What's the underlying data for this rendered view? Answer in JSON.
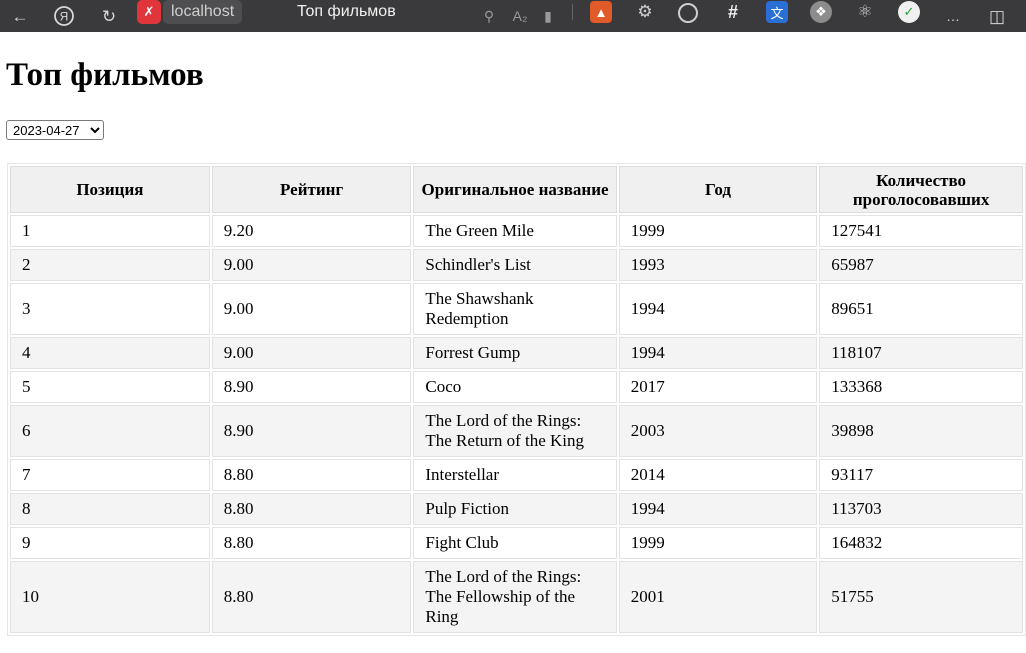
{
  "browser": {
    "url_host": "localhost",
    "tab_title": "Топ фильмов",
    "icons": [
      "back-arrow-icon",
      "yandex-icon",
      "reload-icon",
      "site-blocked-icon",
      "zoom-icon",
      "translate-icon",
      "bookmark-icon",
      "extension-icons",
      "more-icon",
      "sidebar-icon"
    ],
    "more_label": "…"
  },
  "page": {
    "title": "Топ фильмов",
    "date_select": {
      "selected": "2023-04-27",
      "options": [
        "2023-04-27"
      ]
    }
  },
  "table": {
    "headers": [
      "Позиция",
      "Рейтинг",
      "Оригинальное название",
      "Год",
      "Количество проголосовавших"
    ],
    "rows": [
      {
        "position": "1",
        "rating": "9.20",
        "title": "The Green Mile",
        "year": "1999",
        "votes": "127541"
      },
      {
        "position": "2",
        "rating": "9.00",
        "title": "Schindler's List",
        "year": "1993",
        "votes": "65987"
      },
      {
        "position": "3",
        "rating": "9.00",
        "title": "The Shawshank Redemption",
        "year": "1994",
        "votes": "89651"
      },
      {
        "position": "4",
        "rating": "9.00",
        "title": "Forrest Gump",
        "year": "1994",
        "votes": "118107"
      },
      {
        "position": "5",
        "rating": "8.90",
        "title": "Coco",
        "year": "2017",
        "votes": "133368"
      },
      {
        "position": "6",
        "rating": "8.90",
        "title": "The Lord of the Rings: The Return of the King",
        "year": "2003",
        "votes": "39898"
      },
      {
        "position": "7",
        "rating": "8.80",
        "title": "Interstellar",
        "year": "2014",
        "votes": "93117"
      },
      {
        "position": "8",
        "rating": "8.80",
        "title": "Pulp Fiction",
        "year": "1994",
        "votes": "113703"
      },
      {
        "position": "9",
        "rating": "8.80",
        "title": "Fight Club",
        "year": "1999",
        "votes": "164832"
      },
      {
        "position": "10",
        "rating": "8.80",
        "title": "The Lord of the Rings: The Fellowship of the Ring",
        "year": "2001",
        "votes": "51755"
      }
    ]
  }
}
